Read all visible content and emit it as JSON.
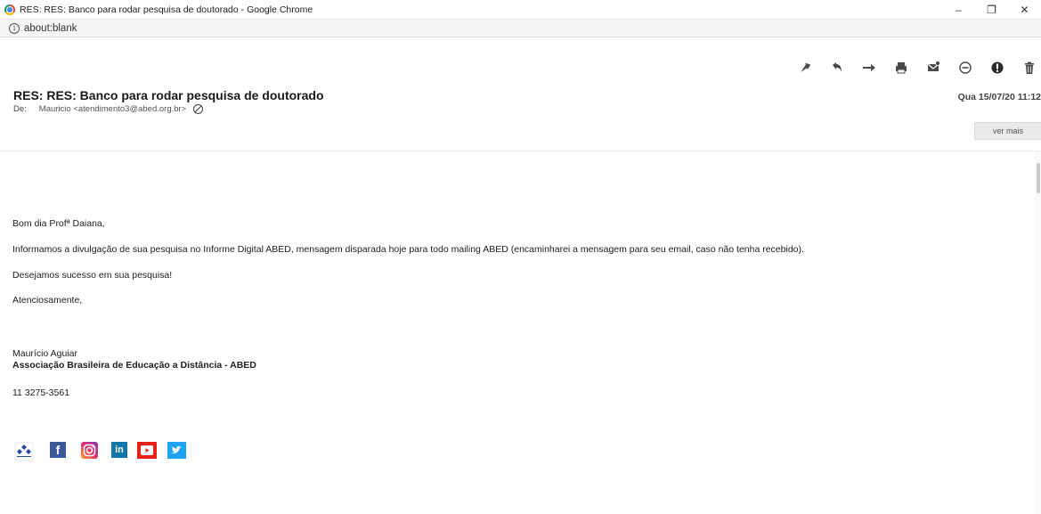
{
  "window": {
    "title": "RES: RES: Banco para rodar pesquisa de doutorado - Google Chrome",
    "minimize": "–",
    "restore": "❐",
    "close": "✕"
  },
  "address": {
    "url": "about:blank"
  },
  "toolbar": {
    "buttons": [
      {
        "name": "reply-icon"
      },
      {
        "name": "reply-all-icon"
      },
      {
        "name": "forward-icon"
      },
      {
        "name": "print-icon"
      },
      {
        "name": "mark-icon"
      },
      {
        "name": "sensitivity-icon"
      },
      {
        "name": "importance-icon"
      },
      {
        "name": "delete-icon"
      }
    ]
  },
  "email": {
    "subject": "RES: RES: Banco para rodar pesquisa de doutorado",
    "date": "Qua 15/07/20 11:12",
    "from_label": "De:",
    "from": "Mauricio <atendimento3@abed.org.br>",
    "ver_mais": "ver mais",
    "greeting": "Bom dia Profª Daiana,",
    "paragraph1": "Informamos a divulgação de sua pesquisa no Informe Digital ABED, mensagem disparada hoje para todo mailing ABED (encaminharei a mensagem para seu email, caso não tenha recebido).",
    "paragraph2": "Desejamos sucesso em sua pesquisa!",
    "closing": "Atenciosamente,",
    "signature_name": "Maurício Aguiar",
    "signature_org": "Associação Brasileira de Educação a Distância - ABED",
    "signature_phone": "11 3275-3561"
  },
  "social": {
    "abed_logo": "ABED",
    "facebook": "f",
    "linkedin": "in",
    "colors": {
      "facebook": "#3b5998",
      "linkedin": "#0e76a8",
      "youtube": "#e62117",
      "twitter": "#1da1f2"
    }
  }
}
